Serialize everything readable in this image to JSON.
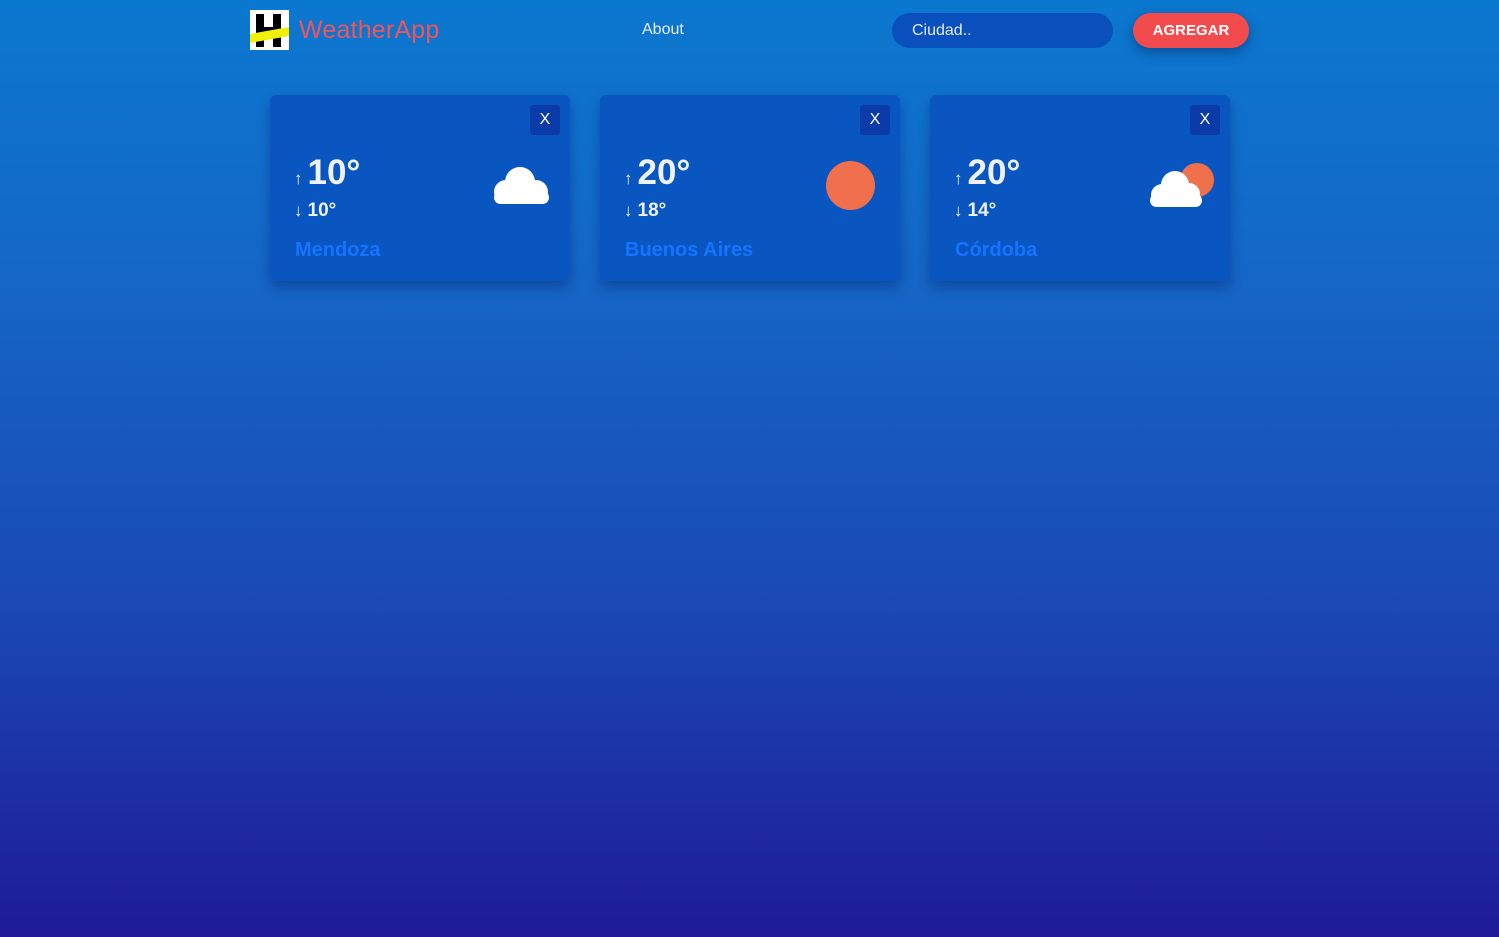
{
  "navbar": {
    "brand_name": "WeatherApp",
    "about_label": "About",
    "search": {
      "placeholder": "Ciudad..",
      "value": ""
    },
    "add_button_label": "AGREGAR"
  },
  "cards": [
    {
      "city": "Mendoza",
      "max_arrow": "↑",
      "max": "10°",
      "min_arrow": "↓",
      "min": "10°",
      "close_label": "X",
      "icon": "cloud-icon"
    },
    {
      "city": "Buenos Aires",
      "max_arrow": "↑",
      "max": "20°",
      "min_arrow": "↓",
      "min": "18°",
      "close_label": "X",
      "icon": "sun-icon"
    },
    {
      "city": "Córdoba",
      "max_arrow": "↑",
      "max": "20°",
      "min_arrow": "↓",
      "min": "14°",
      "close_label": "X",
      "icon": "partly-cloudy-icon"
    }
  ],
  "colors": {
    "accent": "#f24b4d",
    "brand": "#f0555a",
    "city_link": "#1673ff",
    "card_background": "#0a56c0",
    "sun": "#f0704e"
  }
}
